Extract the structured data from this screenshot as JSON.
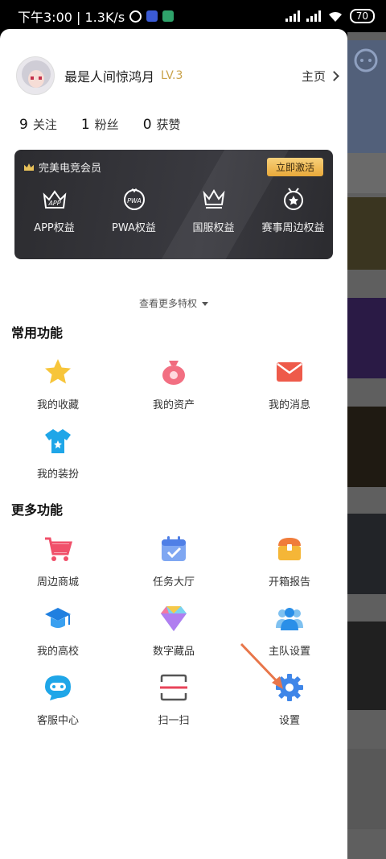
{
  "status_bar": {
    "time_speed": "下午3:00 | 1.3K/s",
    "battery": "70"
  },
  "profile": {
    "nickname": "最是人间惊鸿月",
    "level": "LV.3",
    "homepage": "主页"
  },
  "stats": [
    {
      "num": "9",
      "label": "关注"
    },
    {
      "num": "1",
      "label": "粉丝"
    },
    {
      "num": "0",
      "label": "获赞"
    }
  ],
  "vip": {
    "title": "完美电竞会员",
    "activate": "立即激活",
    "items": [
      {
        "label": "APP权益",
        "icon": "app-crown-icon",
        "glyph": "APP"
      },
      {
        "label": "PWA权益",
        "icon": "pwa-crown-icon",
        "glyph": "PWA"
      },
      {
        "label": "国服权益",
        "icon": "crown-icon",
        "glyph": ""
      },
      {
        "label": "赛事周边权益",
        "icon": "medal-icon",
        "glyph": ""
      }
    ]
  },
  "more_privileges": "查看更多特权",
  "common": {
    "title": "常用功能",
    "items": [
      {
        "label": "我的收藏",
        "icon": "star-icon"
      },
      {
        "label": "我的资产",
        "icon": "money-bag-icon"
      },
      {
        "label": "我的消息",
        "icon": "envelope-icon"
      },
      {
        "label": "我的装扮",
        "icon": "tshirt-icon"
      }
    ]
  },
  "more": {
    "title": "更多功能",
    "items": [
      {
        "label": "周边商城",
        "icon": "shopping-cart-icon"
      },
      {
        "label": "任务大厅",
        "icon": "calendar-check-icon"
      },
      {
        "label": "开箱报告",
        "icon": "treasure-box-icon"
      },
      {
        "label": "我的高校",
        "icon": "graduation-cap-icon"
      },
      {
        "label": "数字藏品",
        "icon": "diamond-icon"
      },
      {
        "label": "主队设置",
        "icon": "team-users-icon"
      },
      {
        "label": "客服中心",
        "icon": "chat-bot-icon"
      },
      {
        "label": "扫一扫",
        "icon": "scan-icon"
      },
      {
        "label": "设置",
        "icon": "gear-icon"
      }
    ]
  },
  "colors": {
    "accent_gold": "#c9a24a",
    "vip_bg": "#323236",
    "arrow": "#e8764a"
  }
}
